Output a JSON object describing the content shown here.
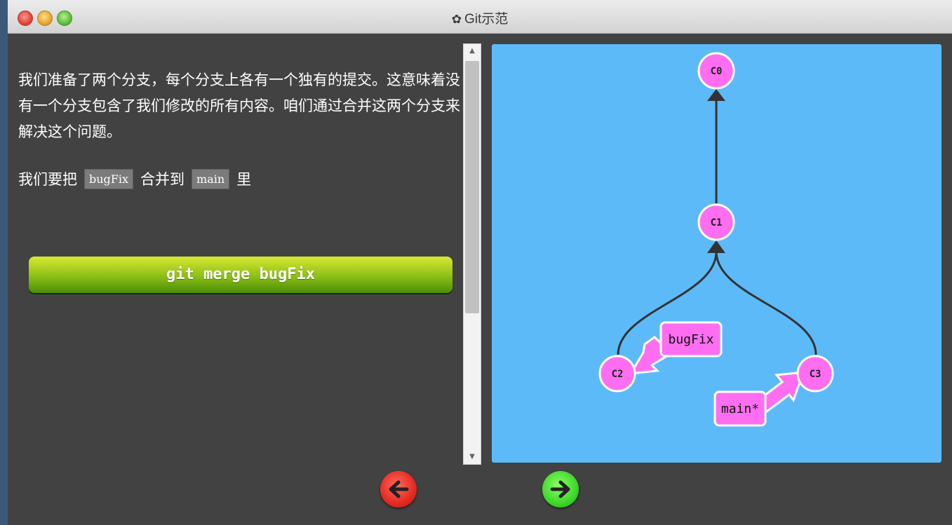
{
  "window": {
    "title": "Git示范",
    "title_icon": "gear-icon"
  },
  "content": {
    "paragraph1": "我们准备了两个分支，每个分支上各有一个独有的提交。这意味着没有一个分支包含了我们修改的所有内容。咱们通过合并这两个分支来解决这个问题。",
    "paragraph2_prefix": "我们要把",
    "branch_a": "bugFix",
    "paragraph2_middle": "合并到",
    "branch_b": "main",
    "paragraph2_suffix": "里",
    "command_button": "git merge bugFix"
  },
  "graph": {
    "background": "#5cbaf9",
    "commit_color": "#ff6ef0",
    "commits": [
      {
        "id": "C0",
        "parent": null
      },
      {
        "id": "C1",
        "parent": "C0"
      },
      {
        "id": "C2",
        "parent": "C1"
      },
      {
        "id": "C3",
        "parent": "C1"
      }
    ],
    "branches": [
      {
        "name": "bugFix",
        "target": "C2"
      },
      {
        "name": "main*",
        "target": "C3"
      }
    ]
  },
  "navigation": {
    "back_icon": "arrow-left-icon",
    "forward_icon": "arrow-right-icon",
    "back_color": "#e52a22",
    "forward_color": "#3ed82a"
  }
}
